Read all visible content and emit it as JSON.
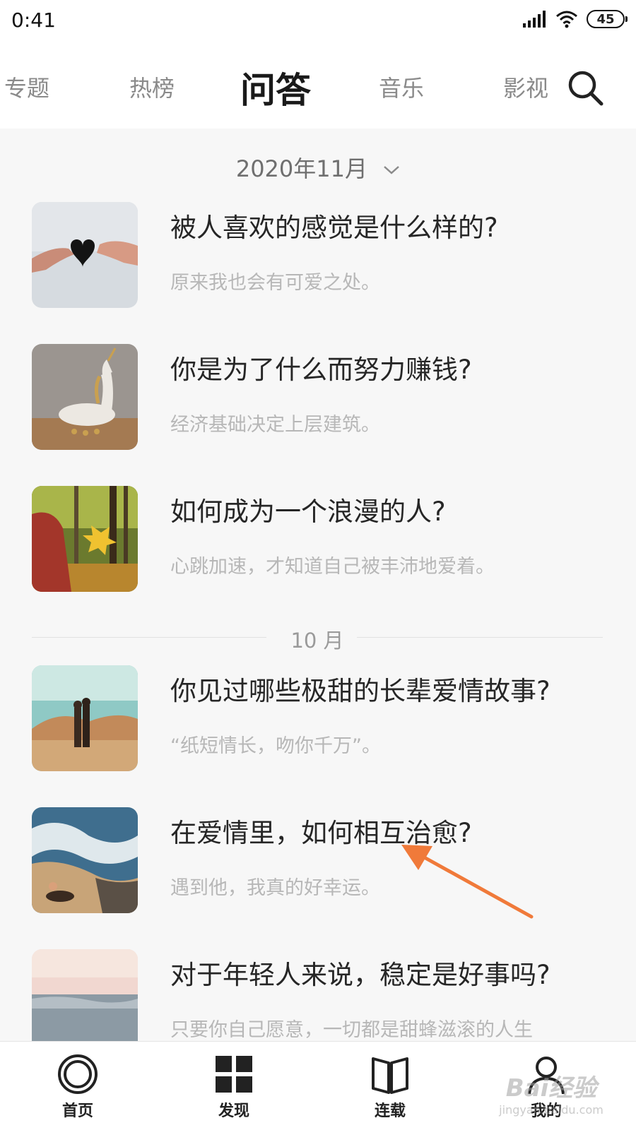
{
  "status_bar": {
    "time": "0:41",
    "battery": "45"
  },
  "top_tabs": [
    {
      "label": "专题"
    },
    {
      "label": "热榜"
    },
    {
      "label": "问答"
    },
    {
      "label": "音乐"
    },
    {
      "label": "影视"
    }
  ],
  "active_tab": "问答",
  "month_selector": {
    "label": "2020年11月"
  },
  "items": [
    {
      "title": "被人喜欢的感觉是什么样的?",
      "subtitle": "原来我也会有可爱之处。"
    },
    {
      "title": "你是为了什么而努力赚钱?",
      "subtitle": "经济基础决定上层建筑。"
    },
    {
      "title": "如何成为一个浪漫的人?",
      "subtitle": "心跳加速，才知道自己被丰沛地爱着。"
    },
    {
      "title": "你见过哪些极甜的长辈爱情故事?",
      "subtitle": "“纸短情长，吻你千万”。"
    },
    {
      "title": "在爱情里，如何相互治愈?",
      "subtitle": "遇到他，我真的好幸运。"
    },
    {
      "title": "对于年轻人来说，稳定是好事吗?",
      "subtitle": "只要你自己愿意，一切都是甜蜂滋滚的人生"
    }
  ],
  "month_divider": {
    "label": "10 月"
  },
  "bottom_nav": [
    {
      "label": "首页"
    },
    {
      "label": "发现"
    },
    {
      "label": "连载"
    },
    {
      "label": "我的"
    }
  ],
  "watermark": {
    "text": "Bai经验",
    "subtext": "jingyan.baidu.com"
  },
  "colors": {
    "annotation_arrow": "#f07a3a",
    "content_bg": "#f7f7f7",
    "subtitle": "#b7b7b7"
  }
}
